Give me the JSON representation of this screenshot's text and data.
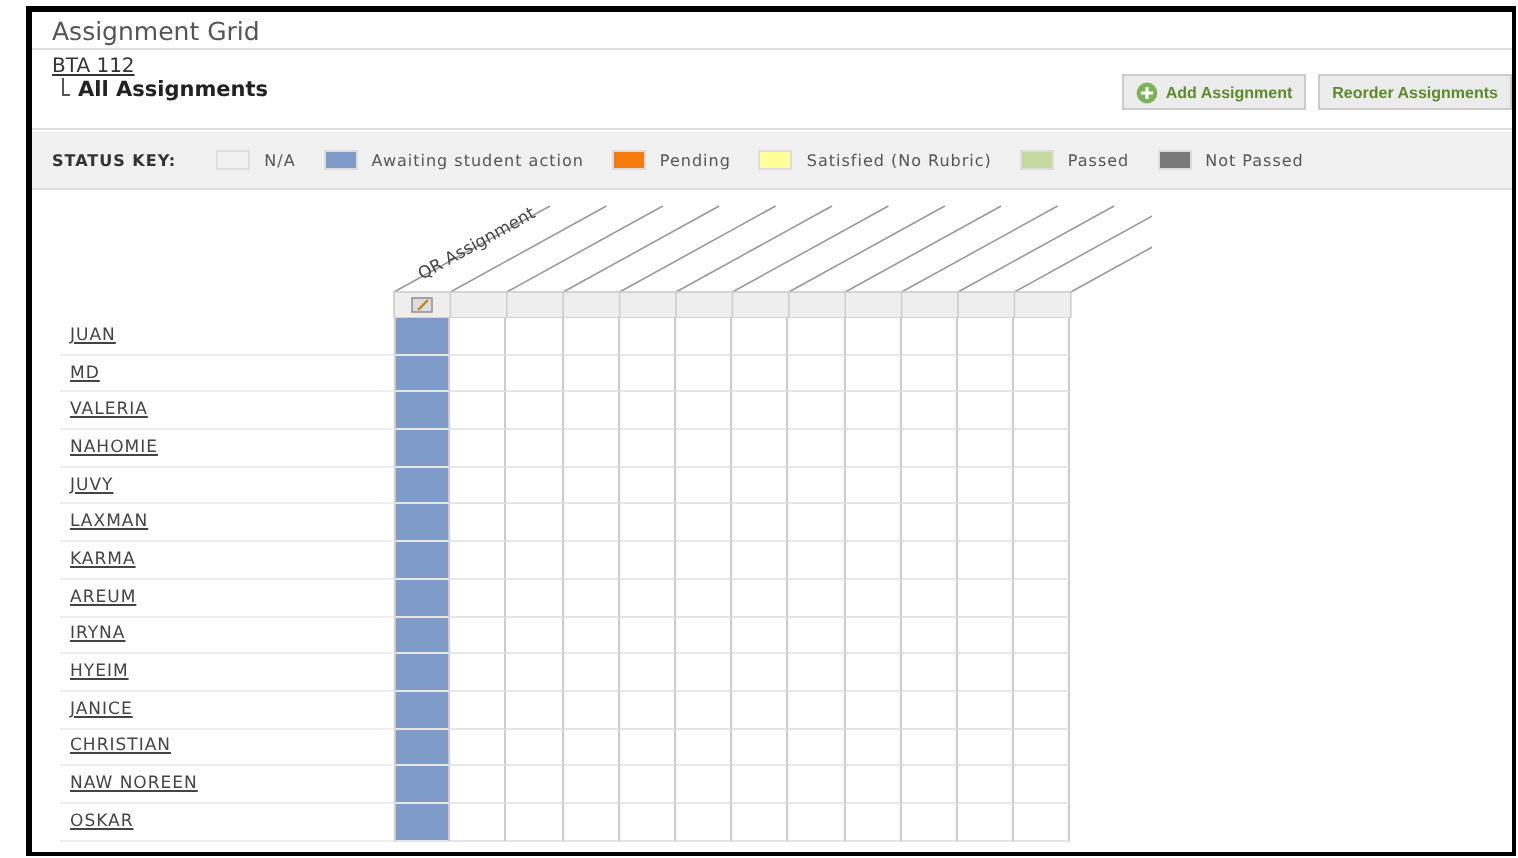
{
  "page": {
    "title": "Assignment Grid"
  },
  "breadcrumb": {
    "course": "BTA 112",
    "current": "All Assignments"
  },
  "buttons": [
    {
      "label": "Add Assignment",
      "kind": "add"
    },
    {
      "label": "Reorder Assignments",
      "kind": "plain"
    }
  ],
  "status_key": {
    "label": "STATUS KEY:",
    "items": [
      {
        "label": "N/A",
        "color": "#f0f0f0"
      },
      {
        "label": "Awaiting student action",
        "color": "#7f9cc9"
      },
      {
        "label": "Pending",
        "color": "#f57c0c"
      },
      {
        "label": "Satisfied (No Rubric)",
        "color": "#ffff99"
      },
      {
        "label": "Passed",
        "color": "#c5d9a1"
      },
      {
        "label": "Not Passed",
        "color": "#7a7a7a"
      }
    ]
  },
  "grid": {
    "assignment": {
      "header": "QR Assignment"
    },
    "students": [
      {
        "name": "JUAN",
        "color": "#7f9cc9"
      },
      {
        "name": "MD",
        "color": "#7f9cc9"
      },
      {
        "name": "VALERIA",
        "color": "#7f9cc9"
      },
      {
        "name": "NAHOMIE",
        "color": "#7f9cc9"
      },
      {
        "name": "JUVY",
        "color": "#7f9cc9"
      },
      {
        "name": "LAXMAN",
        "color": "#7f9cc9"
      },
      {
        "name": "KARMA",
        "color": "#7f9cc9"
      },
      {
        "name": "AREUM",
        "color": "#7f9cc9"
      },
      {
        "name": "IRYNA",
        "color": "#7f9cc9"
      },
      {
        "name": "HYEIM",
        "color": "#7f9cc9"
      },
      {
        "name": "JANICE",
        "color": "#7f9cc9"
      },
      {
        "name": "CHRISTIAN",
        "color": "#7f9cc9"
      },
      {
        "name": "NAW NOREEN",
        "color": "#7f9cc9"
      },
      {
        "name": "OSKAR",
        "color": "#7f9cc9"
      }
    ]
  }
}
